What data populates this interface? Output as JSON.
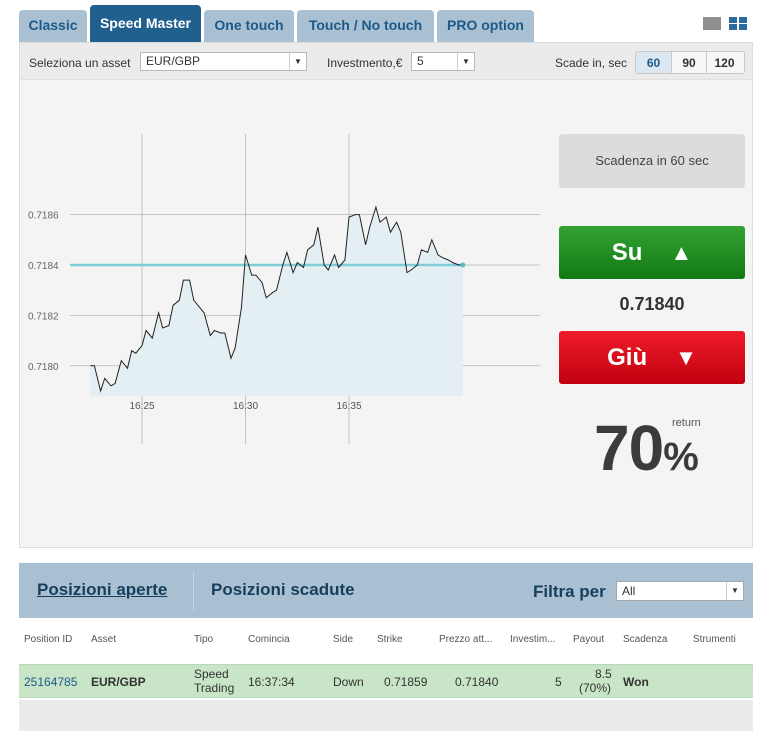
{
  "tabs": [
    {
      "label": "Classic",
      "active": false
    },
    {
      "label": "Speed Master",
      "active": true
    },
    {
      "label": "One touch",
      "active": false
    },
    {
      "label": "Touch / No touch",
      "active": false
    },
    {
      "label": "PRO option",
      "active": false
    }
  ],
  "view_icons": [
    "single-view-icon",
    "grid-view-icon"
  ],
  "toolbar": {
    "asset_label": "Seleziona un asset",
    "asset_value": "EUR/GBP",
    "investment_label": "Investmento,€",
    "investment_value": "5",
    "expiry_label": "Scade in, sec",
    "expiry_options": [
      "60",
      "90",
      "120"
    ],
    "expiry_selected": "60"
  },
  "chart_data": {
    "type": "area",
    "x_ticks": [
      "16:25",
      "16:30",
      "16:35"
    ],
    "y_ticks": [
      "0.7180",
      "0.7182",
      "0.7184",
      "0.7186"
    ],
    "ylim": [
      0.71788,
      0.71892
    ],
    "strike": 0.7184,
    "colors": {
      "line": "#222222",
      "fill": "#e4eff3",
      "strike": "#7fcbd6",
      "grid": "#b5b5b5"
    },
    "x_minutes": [
      -2.5,
      -2.3,
      -2.0,
      -1.8,
      -1.5,
      -1.3,
      -1.0,
      -0.7,
      -0.5,
      -0.3,
      0.0,
      0.2,
      0.5,
      0.8,
      1.0,
      1.3,
      1.5,
      1.8,
      2.0,
      2.3,
      2.5,
      2.8,
      3.0,
      3.3,
      3.5,
      3.8,
      4.0,
      4.3,
      4.5,
      4.8,
      5.0,
      5.3,
      5.5,
      5.8,
      6.0,
      6.3,
      6.5,
      6.8,
      7.0,
      7.3,
      7.5,
      7.8,
      8.0,
      8.3,
      8.5,
      8.8,
      9.0,
      9.3,
      9.5,
      9.8,
      10.0,
      10.3,
      10.5,
      10.8,
      11.0,
      11.3,
      11.5,
      11.8,
      12.0,
      12.3,
      12.5,
      12.8,
      13.0,
      13.3,
      13.5,
      13.8,
      14.0,
      14.3,
      14.5,
      14.8,
      15.0,
      15.3,
      15.5
    ],
    "values": [
      0.718,
      0.718,
      0.7179,
      0.71795,
      0.71792,
      0.71793,
      0.71802,
      0.71799,
      0.71806,
      0.71805,
      0.71808,
      0.71814,
      0.71811,
      0.71821,
      0.71815,
      0.71816,
      0.71824,
      0.71826,
      0.71834,
      0.71834,
      0.71826,
      0.71823,
      0.71821,
      0.71812,
      0.71814,
      0.71813,
      0.71813,
      0.71803,
      0.71807,
      0.71823,
      0.71844,
      0.71836,
      0.71836,
      0.71833,
      0.71827,
      0.71829,
      0.7183,
      0.7184,
      0.71845,
      0.71837,
      0.71841,
      0.71839,
      0.71846,
      0.71848,
      0.71855,
      0.7184,
      0.71838,
      0.71844,
      0.71839,
      0.71842,
      0.71859,
      0.7186,
      0.7186,
      0.71848,
      0.71855,
      0.71863,
      0.71857,
      0.71859,
      0.71853,
      0.71857,
      0.71853,
      0.71837,
      0.71838,
      0.7184,
      0.71846,
      0.71845,
      0.7185,
      0.71844,
      0.71843,
      0.71842,
      0.71841,
      0.7184,
      0.7184
    ]
  },
  "expiry_box": "Scadenza in 60 sec",
  "buttons": {
    "up_label": "Su",
    "up_icon": "▲",
    "down_label": "Giù",
    "down_icon": "▼"
  },
  "current_price": "0.71840",
  "return": {
    "value": "70",
    "sign": "%",
    "label": "return"
  },
  "positions": {
    "tabs": [
      {
        "label": "Posizioni aperte",
        "active": true
      },
      {
        "label": "Posizioni scadute",
        "active": false
      }
    ],
    "filter_label": "Filtra per",
    "filter_value": "All",
    "columns": [
      "Position ID",
      "Asset",
      "Tipo",
      "Comincia",
      "Side",
      "Strike",
      "Prezzo att...",
      "Investim...",
      "Payout",
      "Scadenza",
      "Strumenti"
    ],
    "rows": [
      {
        "id": "25164785",
        "asset": "EUR/GBP",
        "tipo_1": "Speed",
        "tipo_2": "Trading",
        "start": "16:37:34",
        "side": "Down",
        "strike": "0.71859",
        "current": "0.71840",
        "investment": "5",
        "payout_1": "8.5",
        "payout_2": "(70%)",
        "expiry": "Won"
      }
    ]
  }
}
